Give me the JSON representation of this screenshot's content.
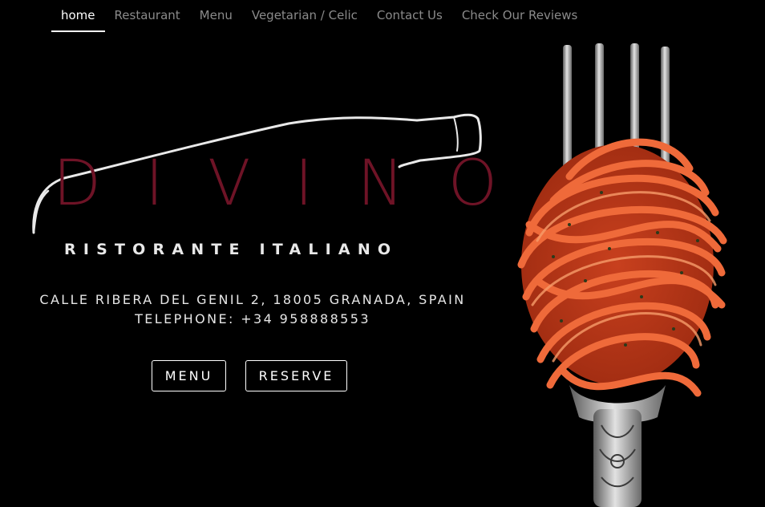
{
  "nav": {
    "items": [
      {
        "label": "home",
        "active": true
      },
      {
        "label": "Restaurant",
        "active": false
      },
      {
        "label": "Menu",
        "active": false
      },
      {
        "label": "Vegetarian / Celic",
        "active": false
      },
      {
        "label": "Contact Us",
        "active": false
      },
      {
        "label": "Check Our Reviews",
        "active": false
      }
    ]
  },
  "logo": {
    "name": "DIVINO",
    "subtitle": "RISTORANTE ITALIANO",
    "name_color": "#6e1326"
  },
  "address": {
    "line1": "CALLE RIBERA DEL GENIL 2, 18005 GRANADA, SPAIN",
    "line2": "TELEPHONE: +34 958888553"
  },
  "buttons": {
    "menu_label": "MENU",
    "reserve_label": "RESERVE"
  },
  "hero": {
    "image": "fork-with-spaghetti",
    "pasta_color": "#e2562a"
  }
}
